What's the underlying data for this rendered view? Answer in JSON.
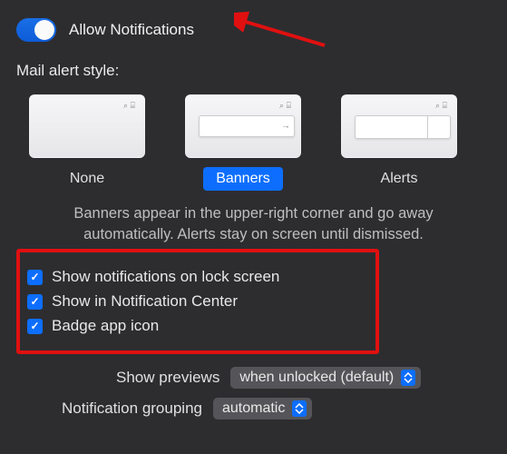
{
  "toggle": {
    "label": "Allow Notifications",
    "on": true
  },
  "section_label": "Mail alert style:",
  "styles": [
    {
      "label": "None"
    },
    {
      "label": "Banners"
    },
    {
      "label": "Alerts"
    }
  ],
  "selected_style_index": 1,
  "description": "Banners appear in the upper-right corner and go away automatically. Alerts stay on screen until dismissed.",
  "checkboxes": [
    {
      "label": "Show notifications on lock screen",
      "checked": true
    },
    {
      "label": "Show in Notification Center",
      "checked": true
    },
    {
      "label": "Badge app icon",
      "checked": true
    }
  ],
  "dropdowns": {
    "previews": {
      "label": "Show previews",
      "value": "when unlocked (default)"
    },
    "grouping": {
      "label": "Notification grouping",
      "value": "automatic"
    }
  }
}
